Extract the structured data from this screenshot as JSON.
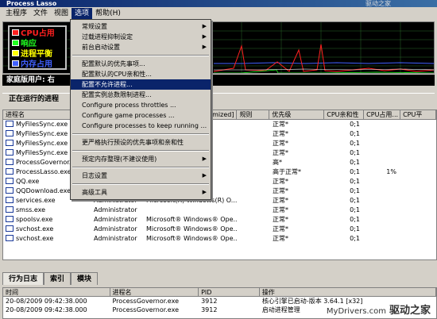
{
  "window": {
    "title": "Process Lasso",
    "top_watermark": "驱动之家"
  },
  "menubar": {
    "items": [
      "主程序",
      "文件",
      "视图",
      "选项",
      "帮助(H)"
    ],
    "active_index": 3
  },
  "graph": {
    "legend": [
      {
        "label": "CPU占用",
        "color": "#ff2020"
      },
      {
        "label": "响应",
        "color": "#20ff20"
      },
      {
        "label": "进程平衡",
        "color": "#ffff00"
      },
      {
        "label": "内存占用",
        "color": "#4060ff"
      }
    ]
  },
  "status": {
    "text": "家庭版用户: 右"
  },
  "running": {
    "header": "正在运行的进程"
  },
  "menu": {
    "groups": [
      [
        {
          "label": "常规设置",
          "submenu": true
        },
        {
          "label": "过载进程抑制设定",
          "submenu": true
        },
        {
          "label": "前台启动设置",
          "submenu": true
        }
      ],
      [
        {
          "label": "配置默认的优先事项...",
          "submenu": false
        },
        {
          "label": "配置默认的CPU亲和性...",
          "submenu": false
        },
        {
          "label": "配置不允许进程...",
          "submenu": false,
          "highlight": true
        },
        {
          "label": "配置实例总数限制进程...",
          "submenu": false
        },
        {
          "label": "Configure process throttles ...",
          "submenu": false
        },
        {
          "label": "Configure game processes ...",
          "submenu": false
        },
        {
          "label": "Configure processes to keep running ...",
          "submenu": false
        }
      ],
      [
        {
          "label": "更严格执行预设的优先事项和亲和性",
          "submenu": false
        }
      ],
      [
        {
          "label": "预定内存整理(不建议使用)",
          "submenu": true
        }
      ],
      [
        {
          "label": "日志设置",
          "submenu": true
        }
      ],
      [
        {
          "label": "高级工具",
          "submenu": true
        }
      ]
    ]
  },
  "process_table": {
    "columns": [
      "进程名",
      "",
      "mized]",
      "规则",
      "优先级",
      "CPU亲和性",
      "CPU占用...",
      "CPU平"
    ],
    "rows": [
      {
        "name": "MyFilesSync.exe",
        "user": "",
        "desc": "",
        "rule": "",
        "priority": "正常*",
        "affinity": "0;1",
        "cpu": ""
      },
      {
        "name": "MyFilesSync.exe",
        "user": "",
        "desc": "",
        "rule": "",
        "priority": "正常*",
        "affinity": "0;1",
        "cpu": ""
      },
      {
        "name": "MyFilesSync.exe",
        "user": "",
        "desc": "",
        "rule": "",
        "priority": "正常*",
        "affinity": "0;1",
        "cpu": ""
      },
      {
        "name": "MyFilesSync.exe",
        "user": "",
        "desc": "",
        "rule": "",
        "priority": "正常*",
        "affinity": "0;1",
        "cpu": ""
      },
      {
        "name": "ProcessGovernor.exe",
        "user": "",
        "desc": "",
        "rule": "",
        "priority": "高*",
        "affinity": "0;1",
        "cpu": ""
      },
      {
        "name": "ProcessLasso.exe",
        "user": "",
        "desc": "",
        "rule": "",
        "priority": "高于正常*",
        "affinity": "0;1",
        "cpu": "1%"
      },
      {
        "name": "QQ.exe",
        "user": "",
        "desc": "",
        "rule": "",
        "priority": "正常*",
        "affinity": "0;1",
        "cpu": ""
      },
      {
        "name": "QQDownload.exe",
        "user": "",
        "desc": "",
        "rule": "",
        "priority": "正常*",
        "affinity": "0;1",
        "cpu": ""
      },
      {
        "name": "services.exe",
        "user": "Administrator",
        "desc": "Microsoft(R) Windows(R) O...",
        "rule": "",
        "priority": "正常*",
        "affinity": "0;1",
        "cpu": ""
      },
      {
        "name": "smss.exe",
        "user": "Administrator",
        "desc": "",
        "rule": "",
        "priority": "正常*",
        "affinity": "0;1",
        "cpu": ""
      },
      {
        "name": "spoolsv.exe",
        "user": "Administrator",
        "desc": "Microsoft® Windows® Ope...",
        "rule": "",
        "priority": "正常*",
        "affinity": "0;1",
        "cpu": ""
      },
      {
        "name": "svchost.exe",
        "user": "Administrator",
        "desc": "Microsoft® Windows® Ope...",
        "rule": "",
        "priority": "正常*",
        "affinity": "0;1",
        "cpu": ""
      },
      {
        "name": "svchost.exe",
        "user": "Administrator",
        "desc": "Microsoft® Windows® Ope...",
        "rule": "",
        "priority": "正常*",
        "affinity": "0;1",
        "cpu": ""
      }
    ]
  },
  "bottom_tabs": [
    "行为日志",
    "索引",
    "模块"
  ],
  "log": {
    "columns": [
      "时间",
      "进程名",
      "PID",
      "操作"
    ],
    "rows": [
      {
        "time": "20-08/2009 09:42:38.000",
        "process": "ProcessGovernor.exe",
        "pid": "3912",
        "action": "核心引擎已启动-版本 3.64.1 [x32]"
      },
      {
        "time": "20-08/2009 09:42:38.000",
        "process": "ProcessGovernor.exe",
        "pid": "3912",
        "action": "启动进程管理"
      }
    ]
  },
  "footer": {
    "site": "MyDrivers.com",
    "brand": "驱动之家"
  }
}
